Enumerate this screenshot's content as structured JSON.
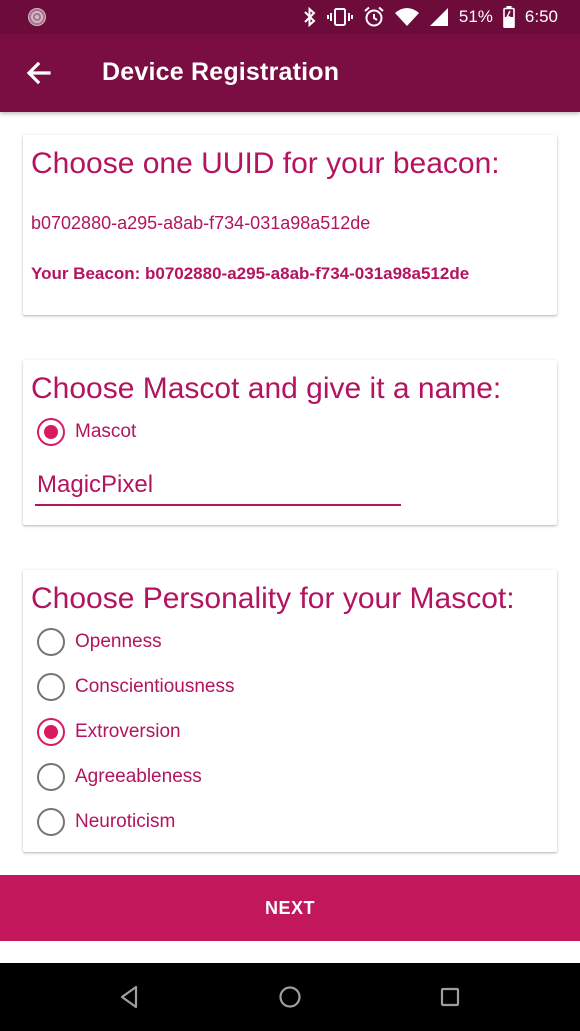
{
  "status_bar": {
    "battery": "51%",
    "time": "6:50",
    "icons": [
      "notification-icon",
      "bluetooth-icon",
      "vibrate-icon",
      "alarm-icon",
      "wifi-icon",
      "signal-icon",
      "battery-icon"
    ]
  },
  "app_bar": {
    "title": "Device Registration",
    "back_icon": "arrow-back-icon"
  },
  "uuid_card": {
    "title": "Choose one UUID for your beacon:",
    "uuid": "b0702880-a295-a8ab-f734-031a98a512de",
    "beacon_line": "Your Beacon: b0702880-a295-a8ab-f734-031a98a512de"
  },
  "mascot_card": {
    "title": "Choose Mascot and give it a name:",
    "radio_label": "Mascot",
    "radio_checked": true,
    "name_value": "MagicPixel"
  },
  "personality_card": {
    "title": "Choose Personality for your Mascot:",
    "options": [
      {
        "label": "Openness",
        "checked": false
      },
      {
        "label": "Conscientiousness",
        "checked": false
      },
      {
        "label": "Extroversion",
        "checked": true
      },
      {
        "label": "Agreeableness",
        "checked": false
      },
      {
        "label": "Neuroticism",
        "checked": false
      }
    ]
  },
  "next_button": {
    "label": "NEXT"
  },
  "nav_bar": {
    "buttons": [
      "back-triangle-icon",
      "home-circle-icon",
      "recents-square-icon"
    ]
  },
  "colors": {
    "status_bar": "#6d0b3a",
    "app_bar": "#7a0d42",
    "accent": "#b3135f",
    "radio_checked": "#d81b60",
    "button": "#c2185b"
  }
}
